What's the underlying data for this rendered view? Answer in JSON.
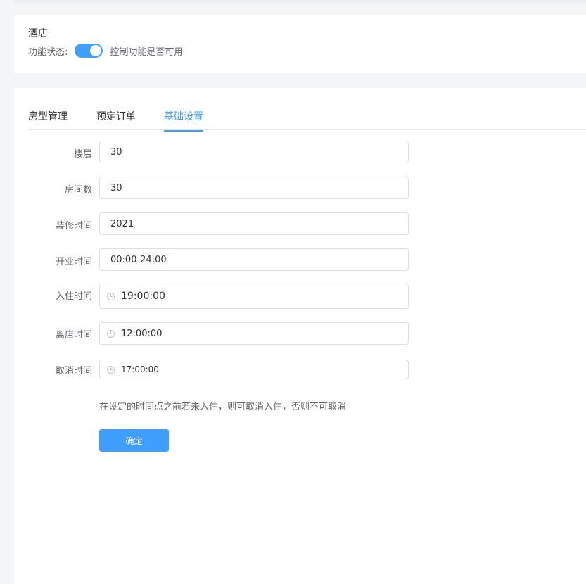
{
  "header": {
    "title": "酒店",
    "status_label": "功能状态:",
    "switch_on": true,
    "status_desc": "控制功能是否可用"
  },
  "tabs": [
    {
      "label": "房型管理",
      "active": false
    },
    {
      "label": "预定订单",
      "active": false
    },
    {
      "label": "基础设置",
      "active": true
    }
  ],
  "form": {
    "floor": {
      "label": "楼层",
      "value": "30"
    },
    "rooms": {
      "label": "房间数",
      "value": "30"
    },
    "renovation": {
      "label": "装修时间",
      "value": "2021"
    },
    "opening": {
      "label": "开业时间",
      "value": "00:00-24:00"
    },
    "checkin": {
      "label": "入住时间",
      "value": "19:00:00"
    },
    "checkout": {
      "label": "离店时间",
      "value": "12:00:00"
    },
    "cancel": {
      "label": "取消时间",
      "value": "17:00:00"
    }
  },
  "hint": "在设定的时间点之前若未入住，则可取消入住，否则不可取消",
  "confirm_label": "确定",
  "colors": {
    "accent": "#409eff",
    "border": "#dcdfe6",
    "text": "#303133",
    "muted": "#606266"
  }
}
